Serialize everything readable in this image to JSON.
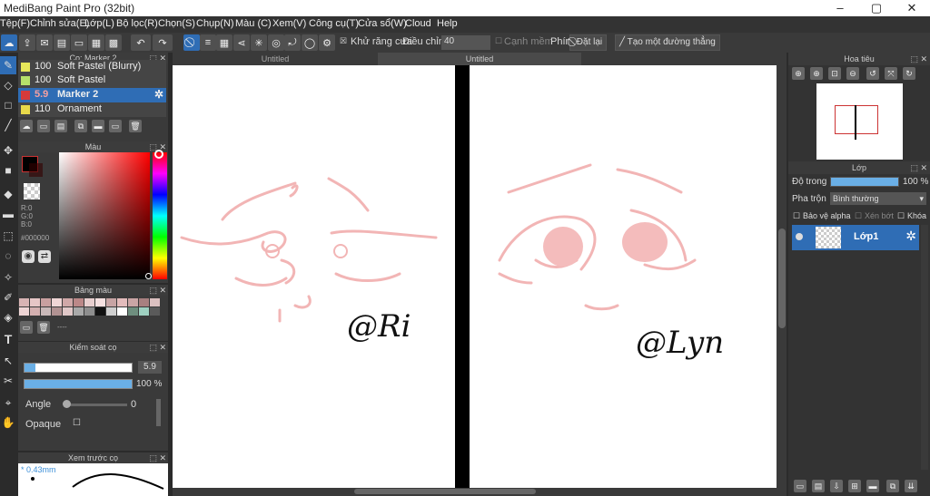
{
  "app": {
    "title": "MediBang Paint Pro (32bit)",
    "window_controls": [
      "–",
      "▢",
      "✕"
    ]
  },
  "menu": [
    "Tệp(F)",
    "Chỉnh sửa(E)",
    "Lớp(L)",
    "Bộ lọc(R)",
    "Chọn(S)",
    "Chụp(N)",
    "Màu (C)",
    "Xem(V)",
    "Công cụ(T)",
    "Cửa sổ(W)",
    "Cloud",
    "Help"
  ],
  "toolbar": {
    "antialias_label": "Khử răng cưa",
    "correction_label": "Điều chỉnh",
    "correction_value": "40",
    "edges_label": "Cạnh mềm",
    "key_label": "Phím",
    "reset_label": "Đặt lại",
    "straight_line_label": "Tạo một đường thẳng"
  },
  "brush_panel": {
    "title": "Cọ: Marker 2",
    "items": [
      {
        "size": "100",
        "name": "Soft Pastel (Blurry)",
        "color": "#e8e85a"
      },
      {
        "size": "100",
        "name": "Soft Pastel",
        "color": "#b5e06a"
      },
      {
        "size": "5.9",
        "name": "Marker 2",
        "color": "#d63a3a",
        "selected": true
      },
      {
        "size": "110",
        "name": "Ornament",
        "color": "#e8d94a"
      }
    ]
  },
  "color_panel": {
    "title": "Màu",
    "r": "R:0",
    "g": "G:0",
    "b": "B:0",
    "hex": "#000000"
  },
  "palette_panel": {
    "title": "Bảng màu",
    "more": "----"
  },
  "brush_control": {
    "title": "Kiểm soát cọ",
    "size": "5.9",
    "opacity": "100 %",
    "angle_label": "Angle",
    "angle_value": "0",
    "opaque_label": "Opaque"
  },
  "preview_panel": {
    "title": "Xem trước cọ",
    "size": "* 0.43mm"
  },
  "tabs": [
    "Untitled",
    "Untitled"
  ],
  "canvas": {
    "signature_left": "@Ri",
    "signature_right": "@Lyn"
  },
  "navigator": {
    "title": "Hoa tiêu"
  },
  "layer_panel": {
    "title": "Lớp",
    "opacity_label": "Độ trong",
    "opacity_value": "100 %",
    "opacity_fraction": 1.0,
    "blend_label": "Pha trộn",
    "blend_value": "Bình thường",
    "protect_alpha": "Bảo vệ alpha",
    "clipping": "Xén bớt",
    "lock": "Khóa",
    "layer_name": "Lớp1"
  },
  "colors": {
    "accent": "#2f6db5",
    "sketch": "#f2b5b5"
  }
}
